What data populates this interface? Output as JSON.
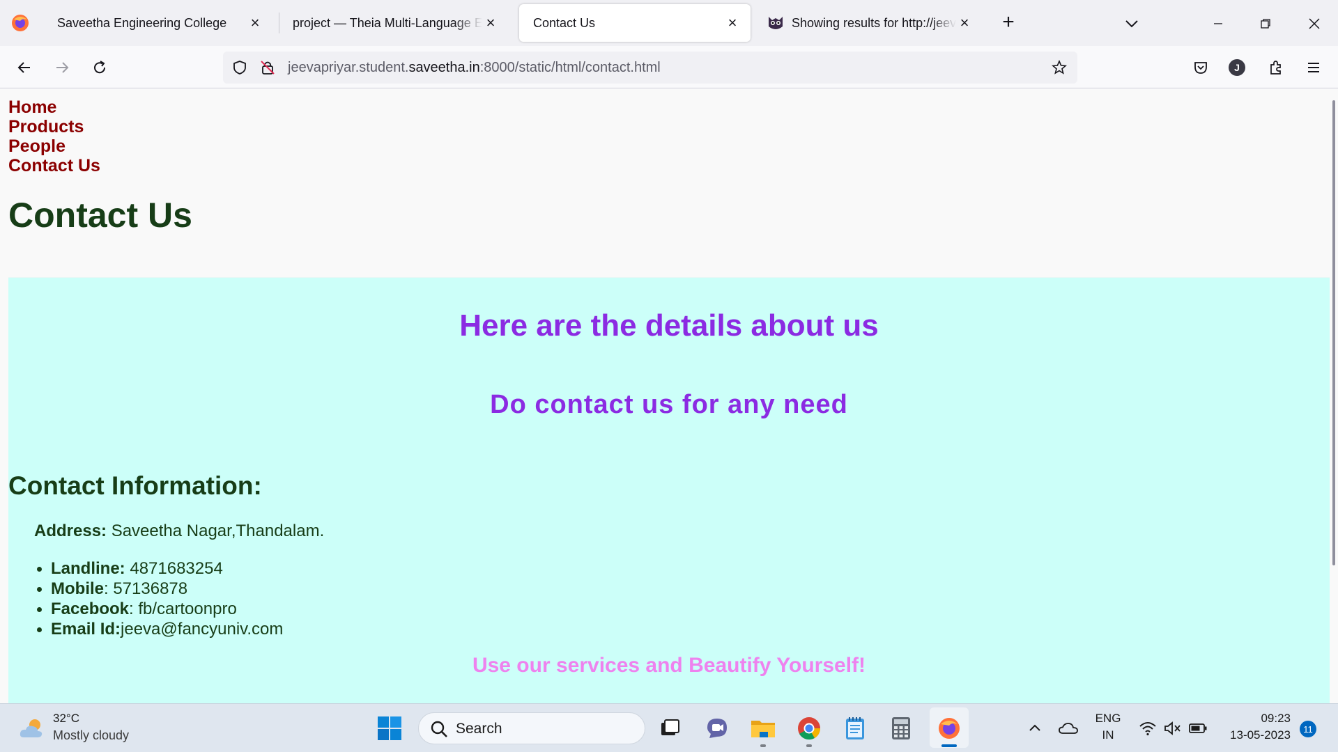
{
  "browser": {
    "tabs": [
      {
        "title": "Saveetha Engineering College",
        "active": false
      },
      {
        "title": "project — Theia Multi-Language Example",
        "active": false
      },
      {
        "title": "Contact Us",
        "active": true
      },
      {
        "title": "Showing results for http://jeevapriyar",
        "active": false
      }
    ],
    "url": {
      "prefix": "jeevapriyar.student.",
      "host": "saveetha.in",
      "suffix": ":8000/static/html/contact.html"
    },
    "account_initial": "J"
  },
  "page": {
    "nav": [
      "Home",
      "Products",
      "People",
      "Contact Us"
    ],
    "title": "Contact Us",
    "heading_primary": "Here are the details about us",
    "heading_secondary": "Do contact us for any need",
    "info_heading": "Contact Information:",
    "address": {
      "label": "Address:",
      "value": " Saveetha Nagar,Thandalam."
    },
    "info_items": [
      {
        "label": "Landline:",
        "value": " 4871683254"
      },
      {
        "label": "Mobile",
        "value": ": 57136878"
      },
      {
        "label": "Facebook",
        "value": ": fb/cartoonpro"
      },
      {
        "label": "Email Id:",
        "value": "jeeva@fancyuniv.com"
      }
    ],
    "tagline": "Use our services and Beautify Yourself!",
    "colors": {
      "nav_link": "#8b0000",
      "heading": "#8b2be2",
      "box_bg": "#ccfff9",
      "tagline": "#ee82ee",
      "dark_green": "#173d17"
    }
  },
  "taskbar": {
    "weather": {
      "temp": "32°C",
      "desc": "Mostly cloudy"
    },
    "search_label": "Search",
    "language": {
      "line1": "ENG",
      "line2": "IN"
    },
    "time": "09:23",
    "date": "13-05-2023",
    "notifications": "11",
    "apps": [
      "start-icon",
      "search-icon",
      "task-view-icon",
      "teams-chat-icon",
      "file-explorer-icon",
      "chrome-icon",
      "notepad-icon",
      "calculator-icon",
      "firefox-icon"
    ]
  }
}
